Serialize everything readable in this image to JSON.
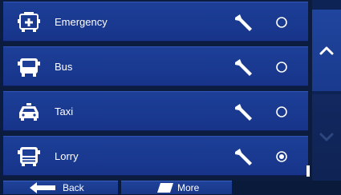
{
  "vehicles": [
    {
      "label": "Emergency",
      "icon": "emergency-vehicle-icon",
      "selected": false
    },
    {
      "label": "Bus",
      "icon": "bus-icon",
      "selected": false
    },
    {
      "label": "Taxi",
      "icon": "taxi-icon",
      "selected": false
    },
    {
      "label": "Lorry",
      "icon": "lorry-icon",
      "selected": true
    }
  ],
  "footer": {
    "back_label": "Back",
    "more_label": "More"
  },
  "colors": {
    "row_bg": "#1d3f97",
    "panel_bg": "#0b1c3f",
    "text": "#ffffff"
  }
}
